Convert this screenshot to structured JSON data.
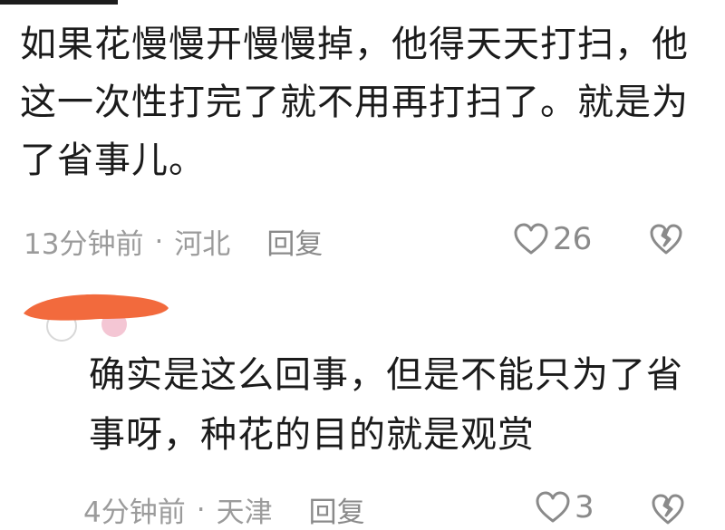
{
  "comments": [
    {
      "text": "如果花慢慢开慢慢掉，他得天天打扫，他这一次性打完了就不用再打扫了。就是为了省事儿。",
      "time": "13分钟前",
      "separator": "·",
      "location": "河北",
      "reply_label": "回复",
      "likes": "26"
    },
    {
      "text": "确实是这么回事，但是不能只为了省事呀，种花的目的就是观赏",
      "time": "4分钟前",
      "separator": "·",
      "location": "天津",
      "reply_label": "回复",
      "likes": "3"
    }
  ],
  "colors": {
    "meta_gray": "#9b9b9b",
    "redaction_orange": "#f26a3d",
    "avatar_pink": "#f4c6d4"
  },
  "icons": [
    "heart-outline-icon",
    "broken-heart-icon"
  ]
}
